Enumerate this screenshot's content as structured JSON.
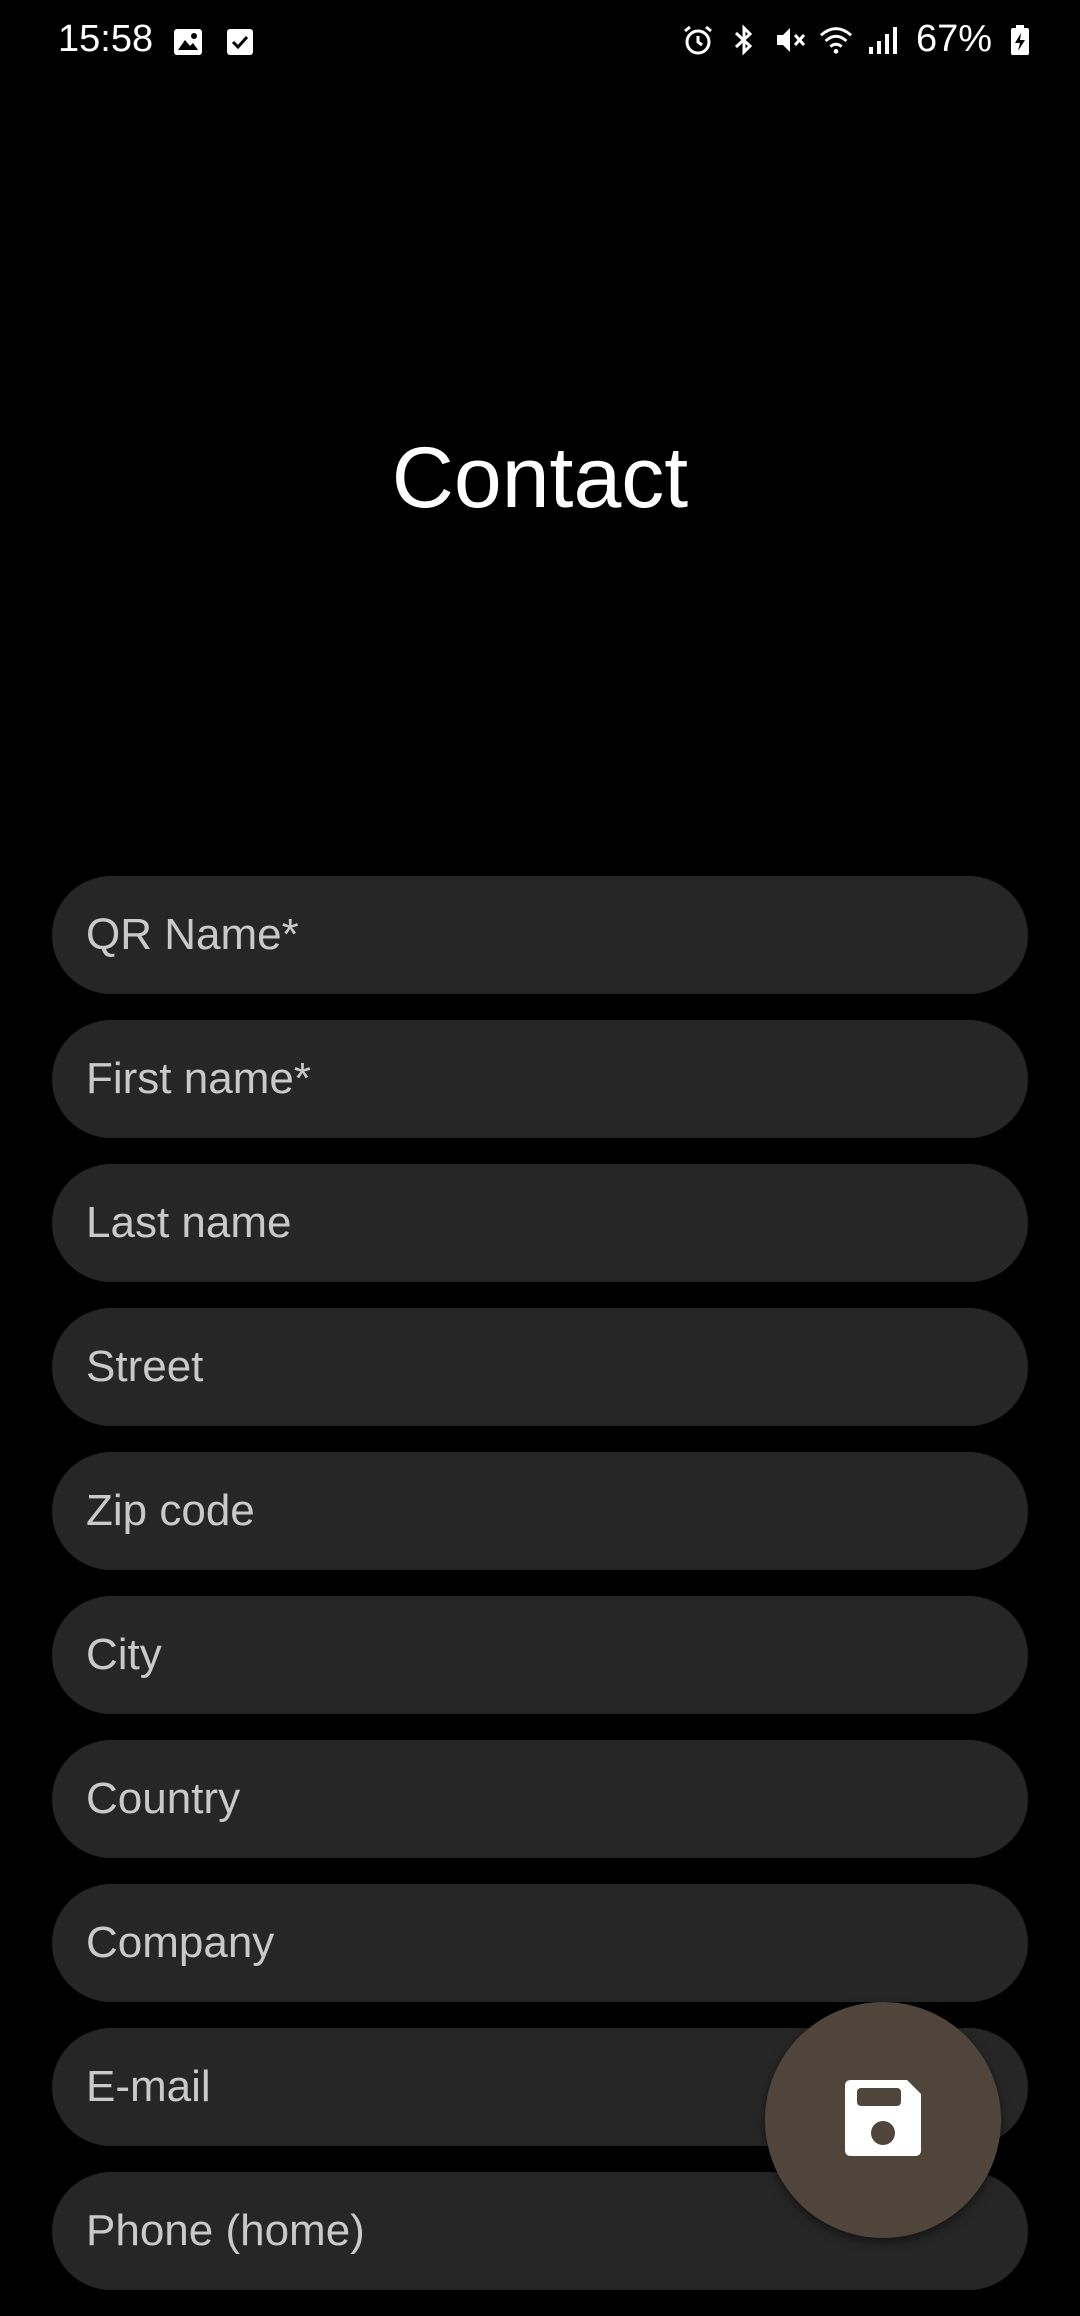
{
  "status_bar": {
    "time": "15:58",
    "left_icons": [
      "gallery-icon",
      "checkbox-icon"
    ],
    "right_icons": [
      "alarm-icon",
      "bluetooth-icon",
      "mute-icon",
      "wifi-icon",
      "signal-icon"
    ],
    "battery": "67%"
  },
  "header": {
    "title": "Contact"
  },
  "form": {
    "fields": [
      {
        "label": "QR Name*"
      },
      {
        "label": "First name*"
      },
      {
        "label": "Last name"
      },
      {
        "label": "Street"
      },
      {
        "label": "Zip code"
      },
      {
        "label": "City"
      },
      {
        "label": "Country"
      },
      {
        "label": "Company"
      },
      {
        "label": "E-mail"
      },
      {
        "label": "Phone (home)"
      }
    ]
  },
  "fab": {
    "icon": "save-icon",
    "color": "#4f453a"
  },
  "colors": {
    "background": "#000000",
    "field_background": "#262626",
    "placeholder_text": "#c9c9c9"
  }
}
